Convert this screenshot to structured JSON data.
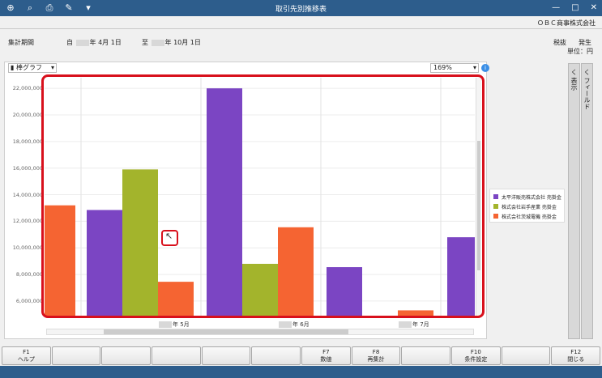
{
  "window": {
    "title": "取引先別推移表",
    "toolbar_icons": [
      "zoom-in-icon",
      "zoom-search-icon",
      "print-icon",
      "edit-icon",
      "dropdown-icon"
    ],
    "controls": [
      "minimize",
      "maximize",
      "close"
    ]
  },
  "company": "ＯＢＣ商事株式会社",
  "period": {
    "label": "集計期間",
    "from_prefix": "自",
    "from_text": "年  4月 1日",
    "to_prefix": "至",
    "to_text": "年 10月 1日"
  },
  "tax": {
    "left": "税抜",
    "right": "発生"
  },
  "unit": "単位：円",
  "chart_type_label": "棒グラフ",
  "zoom_value": "169%",
  "side_panels": {
    "display": "く 表示",
    "field": "く フィールド"
  },
  "chart_data": {
    "type": "bar",
    "categories": [
      "年  5月",
      "年  6月",
      "年  7月"
    ],
    "series": [
      {
        "name": "太平洋販売株式会社 売掛金",
        "color": "#7b45c3",
        "values": [
          12850000,
          22000000,
          8550000
        ]
      },
      {
        "name": "株式会社岩手産業 売掛金",
        "color": "#a3b42c",
        "values": [
          15900000,
          8800000,
          null
        ]
      },
      {
        "name": "株式会社茨城電機 売掛金",
        "color": "#f56432",
        "values": [
          7450000,
          11550000,
          5300000
        ]
      }
    ],
    "partial_bars": [
      {
        "series": "株式会社茨城電機 売掛金",
        "value": 13200000,
        "position": "before-first"
      },
      {
        "series": "太平洋販売株式会社 売掛金",
        "value": 10800000,
        "position": "after-last"
      }
    ],
    "ylim": [
      5000000,
      23000000
    ],
    "yticks": [
      "22,000,000",
      "20,000,000",
      "18,000,000",
      "16,000,000",
      "14,000,000",
      "12,000,000",
      "10,000,000",
      "8,000,000",
      "6,000,000"
    ],
    "legend_position": "right"
  },
  "fkeys": [
    {
      "key": "F1",
      "label": "ヘルプ"
    },
    {
      "key": "",
      "label": ""
    },
    {
      "key": "",
      "label": ""
    },
    {
      "key": "",
      "label": ""
    },
    {
      "key": "",
      "label": ""
    },
    {
      "key": "",
      "label": ""
    },
    {
      "key": "F7",
      "label": "数値"
    },
    {
      "key": "F8",
      "label": "再集計"
    },
    {
      "key": "",
      "label": ""
    },
    {
      "key": "F10",
      "label": "条件設定"
    },
    {
      "key": "",
      "label": ""
    },
    {
      "key": "F12",
      "label": "閉じる"
    }
  ]
}
